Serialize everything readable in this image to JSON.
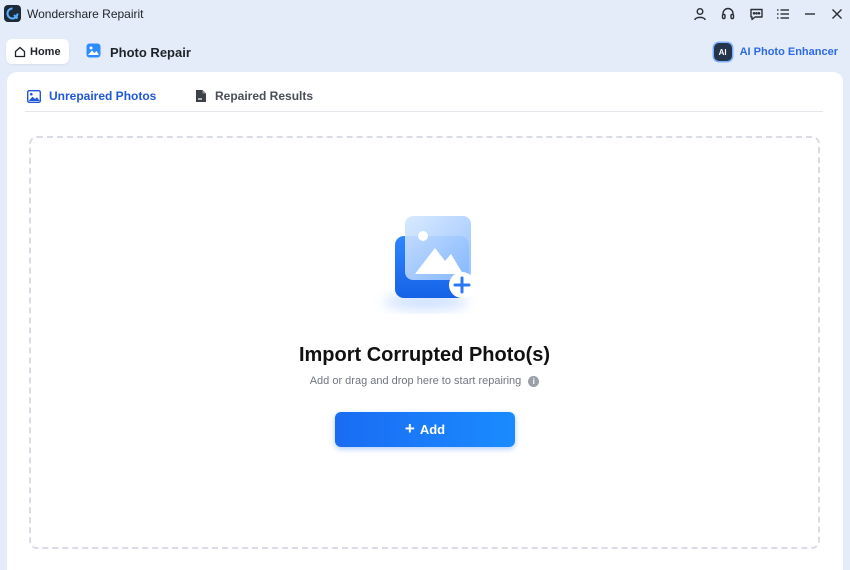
{
  "window": {
    "title": "Wondershare Repairit",
    "icons": [
      "user-icon",
      "headset-icon",
      "chat-icon",
      "menu-icon",
      "minimize-icon",
      "close-icon"
    ]
  },
  "header": {
    "home_label": "Home",
    "module_title": "Photo Repair",
    "enhancer_badge": "AI",
    "enhancer_label": "AI Photo Enhancer"
  },
  "tabs": {
    "unrepaired": "Unrepaired Photos",
    "repaired": "Repaired Results"
  },
  "dropzone": {
    "title": "Import Corrupted Photo(s)",
    "subtitle": "Add or drag and drop here to start repairing",
    "info_glyph": "i",
    "add_label": "Add"
  },
  "colors": {
    "accent": "#1f58d6",
    "button": "#1a7cff",
    "background": "#e3ecf8"
  }
}
